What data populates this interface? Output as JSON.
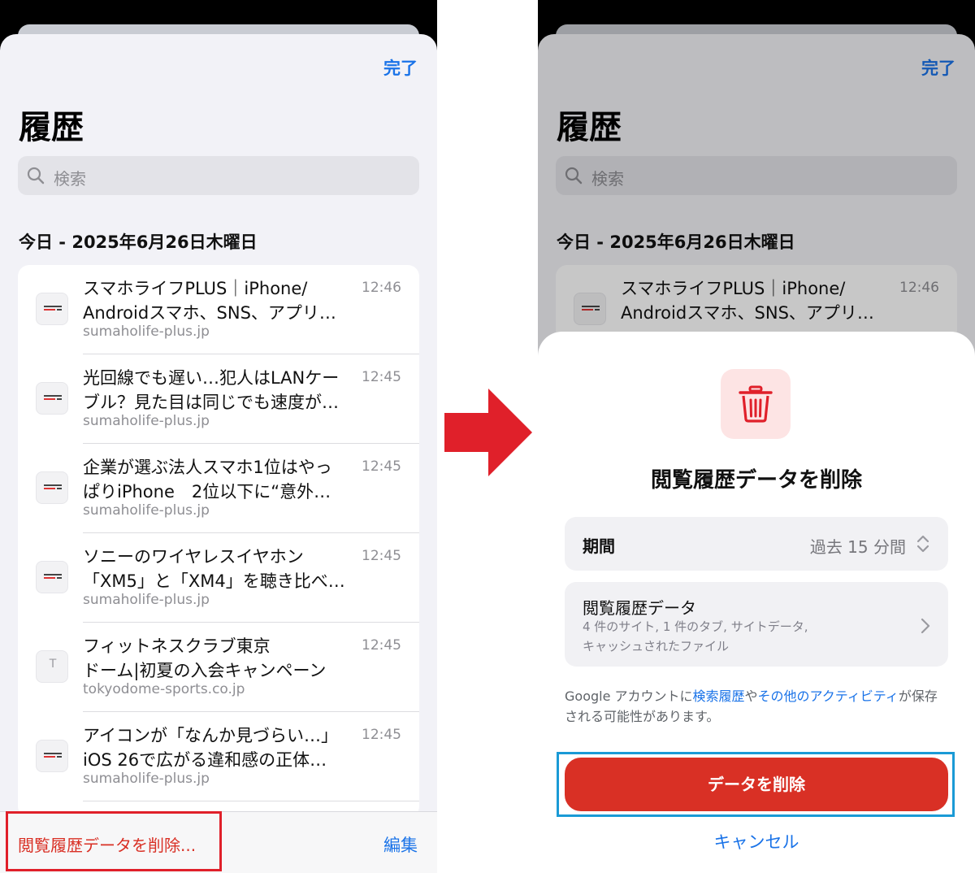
{
  "left": {
    "done_label": "完了",
    "title": "履歴",
    "search_placeholder": "検索",
    "date_header": "今日 - 2025年6月26日木曜日",
    "items": [
      {
        "title1": "スマホライフPLUS｜iPhone/",
        "title2": "Androidスマホ、SNS、アプリ…",
        "domain": "sumaholife-plus.jp",
        "time": "12:46",
        "icon": "sumaholife-favicon"
      },
      {
        "title1": "光回線でも遅い…犯人はLANケー",
        "title2": "ブル？見た目は同じでも速度が…",
        "domain": "sumaholife-plus.jp",
        "time": "12:45",
        "icon": "sumaholife-favicon"
      },
      {
        "title1": "企業が選ぶ法人スマホ1位はやっ",
        "title2": "ぱりiPhone　2位以下に“意外…",
        "domain": "sumaholife-plus.jp",
        "time": "12:45",
        "icon": "sumaholife-favicon"
      },
      {
        "title1": "ソニーのワイヤレスイヤホン",
        "title2": "「XM5」と「XM4」を聴き比べ…",
        "domain": "sumaholife-plus.jp",
        "time": "12:45",
        "icon": "sumaholife-favicon"
      },
      {
        "title1": "フィットネスクラブ東京",
        "title2": "ドーム|初夏の入会キャンペーン",
        "domain": "tokyodome-sports.co.jp",
        "time": "12:45",
        "icon": "letter-favicon",
        "letter": "T"
      },
      {
        "title1": "アイコンが「なんか見づらい…」",
        "title2": "iOS 26で広がる違和感の正体…",
        "domain": "sumaholife-plus.jp",
        "time": "12:45",
        "icon": "sumaholife-favicon"
      }
    ],
    "clear_label": "閲覧履歴データを削除...",
    "edit_label": "編集"
  },
  "right": {
    "done_label": "完了",
    "title": "履歴",
    "search_placeholder": "検索",
    "date_header": "今日 - 2025年6月26日木曜日",
    "peek_item": {
      "title1": "スマホライフPLUS｜iPhone/",
      "title2": "Androidスマホ、SNS、アプリ…",
      "time": "12:46"
    },
    "dialog": {
      "title": "閲覧履歴データを削除",
      "period_label": "期間",
      "period_value": "過去 15 分間",
      "data_label": "閲覧履歴データ",
      "data_sub1": "4 件のサイト, 1 件のタブ, サイトデータ,",
      "data_sub2": "キャッシュされたファイル",
      "note_prefix": "Google アカウントに",
      "note_link1": "検索履歴",
      "note_mid": "や",
      "note_link2": "その他のアクティビティ",
      "note_suffix": "が保存される可能性があります。",
      "delete_label": "データを削除",
      "cancel_label": "キャンセル"
    }
  },
  "colors": {
    "accent_blue": "#1a73e8",
    "destructive_red": "#d93025",
    "arrow_red": "#e0202a",
    "highlight_blue": "#1a9ad6"
  }
}
